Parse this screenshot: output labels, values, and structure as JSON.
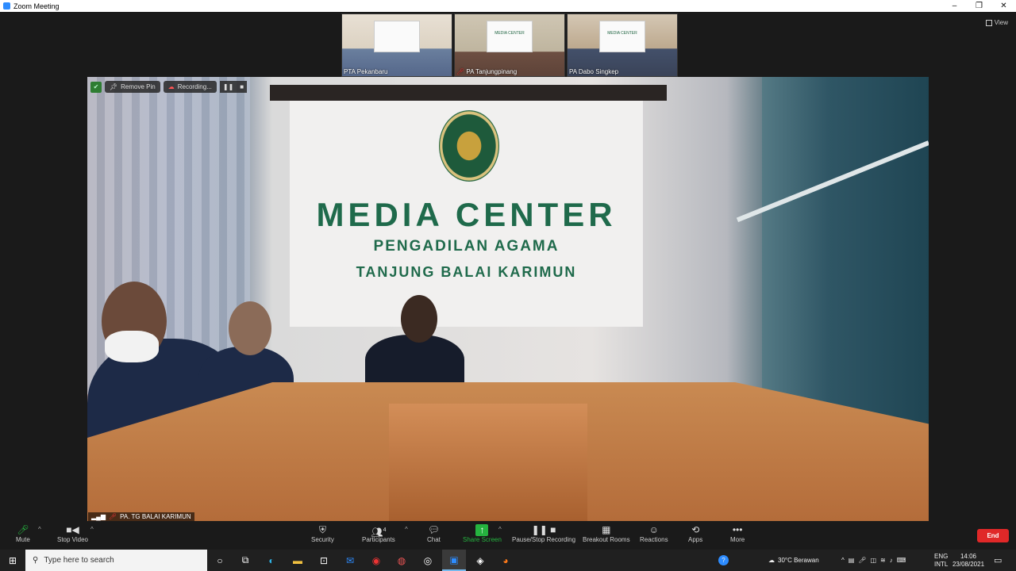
{
  "window": {
    "title": "Zoom Meeting",
    "controls": [
      "–",
      "❐",
      "✕"
    ]
  },
  "view_label": "View",
  "thumbnails": [
    {
      "label": "PTA Pekanbaru",
      "board_text": "",
      "muted": false
    },
    {
      "label": "PA Tanjungpinang",
      "board_text": "MEDIA CENTER",
      "muted": true
    },
    {
      "label": "PA Dabo Singkep",
      "board_text": "MEDIA CENTER",
      "muted": false
    }
  ],
  "main_video": {
    "sign_title": "MEDIA CENTER",
    "sign_line1": "PENGADILAN AGAMA",
    "sign_line2": "TANJUNG BALAI KARIMUN",
    "participant_name": "PA. TG BALAI KARIMUN"
  },
  "overlay": {
    "remove_pin": "Remove Pin",
    "recording": "Recording...",
    "pause_icon": "pause-icon",
    "stop_icon": "stop-icon"
  },
  "toolbar": {
    "mute": "Mute",
    "stop_video": "Stop Video",
    "security": "Security",
    "participants": "Participants",
    "participants_count": "4",
    "chat": "Chat",
    "share_screen": "Share Screen",
    "recording": "Pause/Stop Recording",
    "breakout": "Breakout Rooms",
    "reactions": "Reactions",
    "apps": "Apps",
    "more": "More",
    "end": "End"
  },
  "taskbar": {
    "search_placeholder": "Type here to search",
    "weather": "30°C  Berawan",
    "lang1": "ENG",
    "lang2": "INTL",
    "time": "14:06",
    "date": "23/08/2021"
  },
  "colors": {
    "accent": "#2d8cff",
    "end": "#e02828",
    "share": "#25b33f",
    "sign": "#1f6a4b"
  }
}
